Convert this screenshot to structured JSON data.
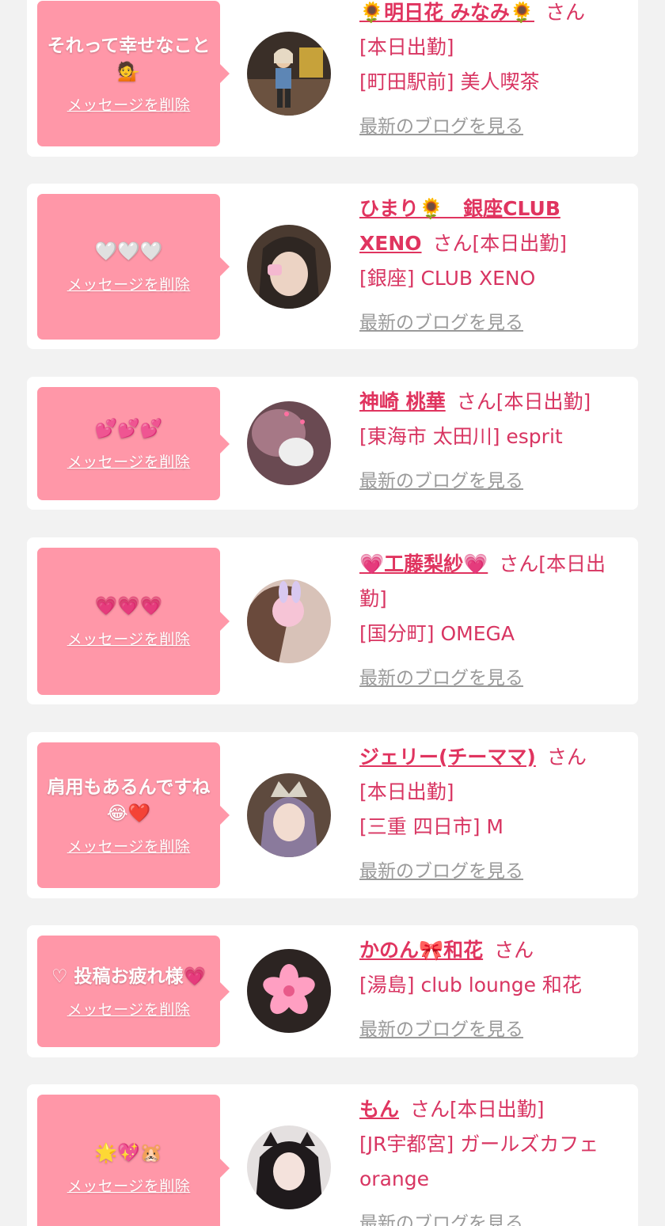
{
  "common": {
    "delete_label": "メッセージを削除",
    "blog_label": "最新のブログを見る",
    "san": "さん"
  },
  "cards": [
    {
      "message": "それって幸せなこと💁",
      "name": "🌻明日花 みなみ🌻",
      "status": "[本日出勤]",
      "shop": "[町田駅前] 美人喫茶"
    },
    {
      "message": "🤍🤍🤍",
      "name": "ひまり🌻　銀座CLUB XENO",
      "status": "[本日出勤]",
      "shop": "[銀座] CLUB XENO"
    },
    {
      "message": "💕💕💕",
      "name": "神崎 桃華",
      "status": "[本日出勤]",
      "shop": "[東海市 太田川] esprit"
    },
    {
      "message": "💗💗💗",
      "name": "💗工藤梨紗💗",
      "status": "[本日出勤]",
      "shop": "[国分町] OMEGA"
    },
    {
      "message": "肩用もあるんですね😂❤️",
      "name": "ジェリー(チーママ)",
      "status": "[本日出勤]",
      "shop": "[三重 四日市] M"
    },
    {
      "message": "♡ 投稿お疲れ様💗",
      "name": "かのん🎀和花",
      "status": "",
      "shop": "[湯島] club lounge 和花"
    },
    {
      "message": "🌟💖🐹",
      "name": "もん",
      "status": "[本日出勤]",
      "shop": "[JR宇都宮] ガールズカフェ orange"
    }
  ],
  "colors": {
    "background": "#f2f2f2",
    "card": "#ffffff",
    "bubble": "#ff97a8",
    "name": "#e0345f",
    "text": "#d83562",
    "link_gray": "#9a9a9a"
  }
}
